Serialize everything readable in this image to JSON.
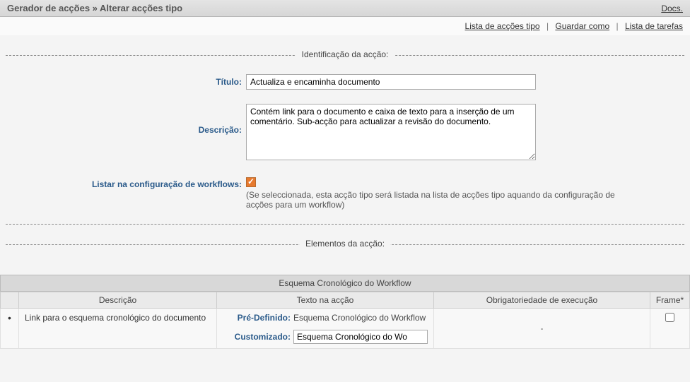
{
  "header": {
    "title": "Gerador de acções » Alterar acções tipo",
    "docs_link": "Docs."
  },
  "toolbar": {
    "list_action_types": "Lista de acções tipo",
    "save_as": "Guardar como",
    "task_list": "Lista de tarefas"
  },
  "identification": {
    "legend": "Identificação da acção:",
    "labels": {
      "title": "Título:",
      "description": "Descrição:",
      "list_workflow": "Listar na configuração de workflows:"
    },
    "values": {
      "title": "Actualiza e encaminha documento",
      "description": "Contém link para o documento e caixa de texto para a inserção de um comentário. Sub-acção para actualizar a revisão do documento.",
      "list_workflow_checked": true,
      "help": "(Se seleccionada, esta acção tipo será listada na lista de acções tipo aquando da configuração de acções para um workflow)"
    }
  },
  "elements": {
    "legend": "Elementos da acção:"
  },
  "table": {
    "section_title": "Esquema Cronológico do Workflow",
    "columns": {
      "description": "Descrição",
      "action_text": "Texto na acção",
      "mandatory": "Obrigatoriedade de execução",
      "frame": "Frame*"
    },
    "row": {
      "description": "Link para o esquema cronológico do documento",
      "predef_label": "Pré-Definido:",
      "predef_value": "Esquema Cronológico do Workflow",
      "custom_label": "Customizado:",
      "custom_value": "Esquema Cronológico do Wo",
      "mandatory": "-",
      "frame_checked": false
    }
  }
}
